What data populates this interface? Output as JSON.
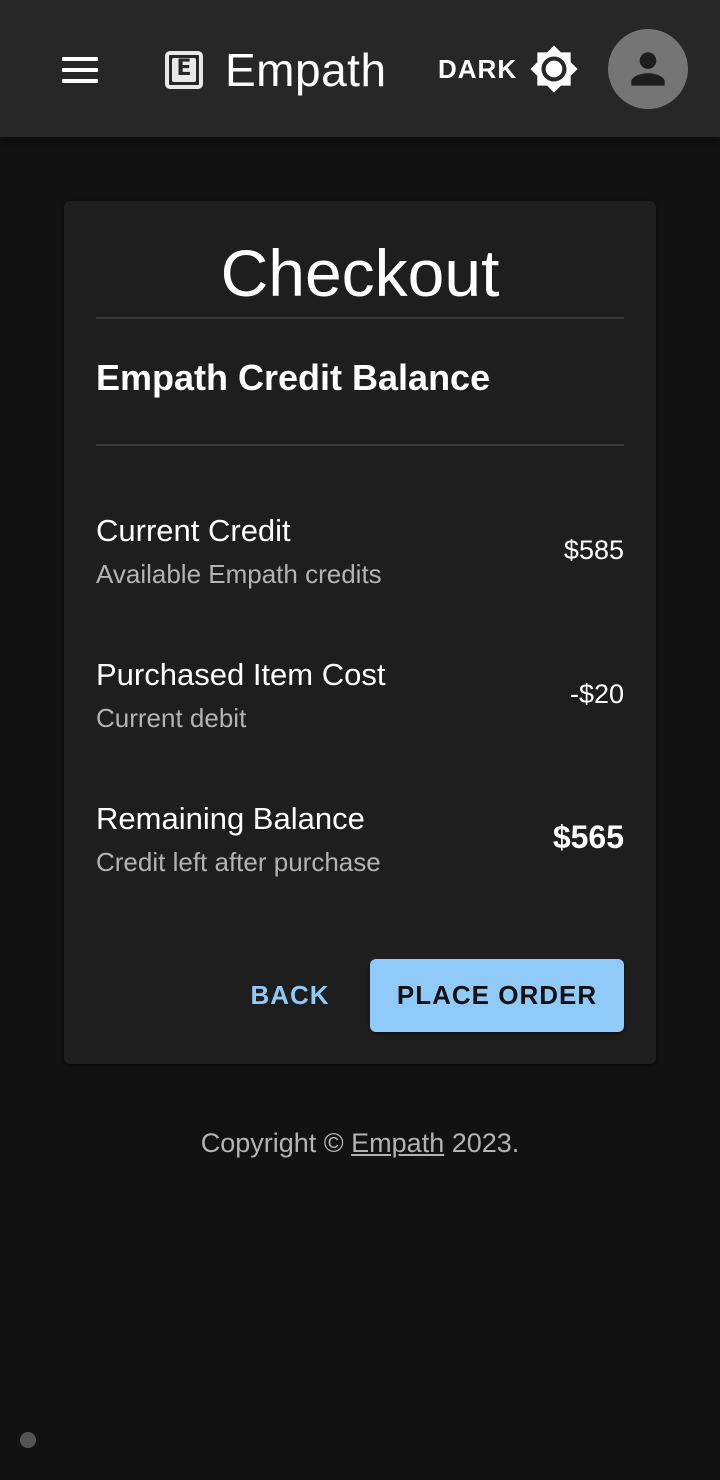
{
  "colors": {
    "background": "#121212",
    "appbar": "#272727",
    "card": "#1e1e1e",
    "accent": "#90caf9",
    "avatar": "#757575",
    "secondary_text": "#b3b3b3"
  },
  "header": {
    "menu_icon": "hamburger-menu-icon",
    "brand_icon": "e-square-icon",
    "brand_letter": "E",
    "brand_name": "Empath",
    "theme_label": "DARK",
    "theme_icon": "brightness-icon",
    "avatar_icon": "person-icon"
  },
  "checkout": {
    "title": "Checkout",
    "section_title": "Empath Credit Balance",
    "rows": [
      {
        "primary": "Current Credit",
        "secondary": "Available Empath credits",
        "amount": "$585"
      },
      {
        "primary": "Purchased Item Cost",
        "secondary": "Current debit",
        "amount": "-$20"
      },
      {
        "primary": "Remaining Balance",
        "secondary": "Credit left after purchase",
        "amount": "$565"
      }
    ],
    "back_label": "BACK",
    "place_order_label": "PLACE ORDER"
  },
  "footer": {
    "prefix": "Copyright © ",
    "link_text": "Empath",
    "suffix": " 2023."
  }
}
